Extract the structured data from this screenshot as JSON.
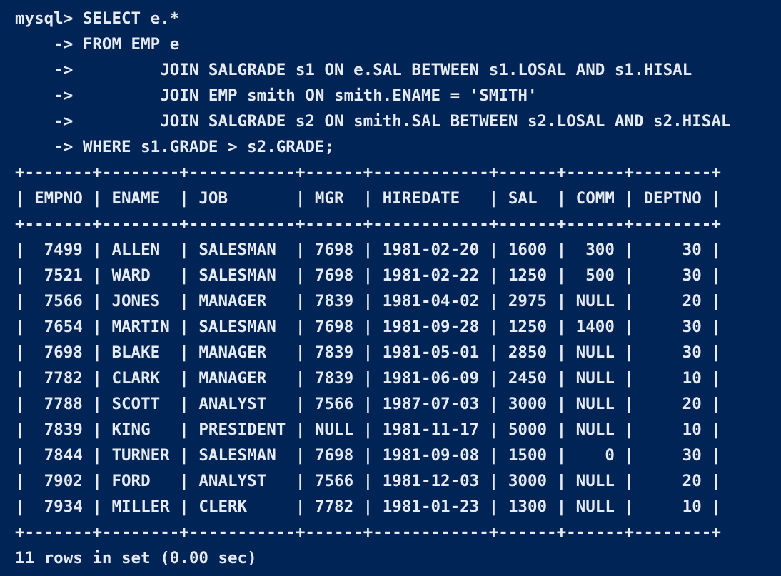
{
  "terminal": {
    "query_lines": [
      "mysql> SELECT e.*",
      "    -> FROM EMP e",
      "    ->         JOIN SALGRADE s1 ON e.SAL BETWEEN s1.LOSAL AND s1.HISAL",
      "    ->         JOIN EMP smith ON smith.ENAME = 'SMITH'",
      "    ->         JOIN SALGRADE s2 ON smith.SAL BETWEEN s2.LOSAL AND s2.HISAL",
      "    -> WHERE s1.GRADE > s2.GRADE;"
    ],
    "table": {
      "border": "+-------+--------+-----------+------+------------+------+------+--------+",
      "header": "| EMPNO | ENAME  | JOB       | MGR  | HIREDATE   | SAL  | COMM | DEPTNO |",
      "columns": [
        "EMPNO",
        "ENAME",
        "JOB",
        "MGR",
        "HIREDATE",
        "SAL",
        "COMM",
        "DEPTNO"
      ],
      "rows": [
        "|  7499 | ALLEN  | SALESMAN  | 7698 | 1981-02-20 | 1600 |  300 |     30 |",
        "|  7521 | WARD   | SALESMAN  | 7698 | 1981-02-22 | 1250 |  500 |     30 |",
        "|  7566 | JONES  | MANAGER   | 7839 | 1981-04-02 | 2975 | NULL |     20 |",
        "|  7654 | MARTIN | SALESMAN  | 7698 | 1981-09-28 | 1250 | 1400 |     30 |",
        "|  7698 | BLAKE  | MANAGER   | 7839 | 1981-05-01 | 2850 | NULL |     30 |",
        "|  7782 | CLARK  | MANAGER   | 7839 | 1981-06-09 | 2450 | NULL |     10 |",
        "|  7788 | SCOTT  | ANALYST   | 7566 | 1987-07-03 | 3000 | NULL |     20 |",
        "|  7839 | KING   | PRESIDENT | NULL | 1981-11-17 | 5000 | NULL |     10 |",
        "|  7844 | TURNER | SALESMAN  | 7698 | 1981-09-08 | 1500 |    0 |     30 |",
        "|  7902 | FORD   | ANALYST   | 7566 | 1981-12-03 | 3000 | NULL |     20 |",
        "|  7934 | MILLER | CLERK     | 7782 | 1981-01-23 | 1300 | NULL |     10 |"
      ]
    },
    "status": "11 rows in set (0.00 sec)",
    "colors": {
      "background": "#012456",
      "text": "#e6ebf2"
    }
  }
}
